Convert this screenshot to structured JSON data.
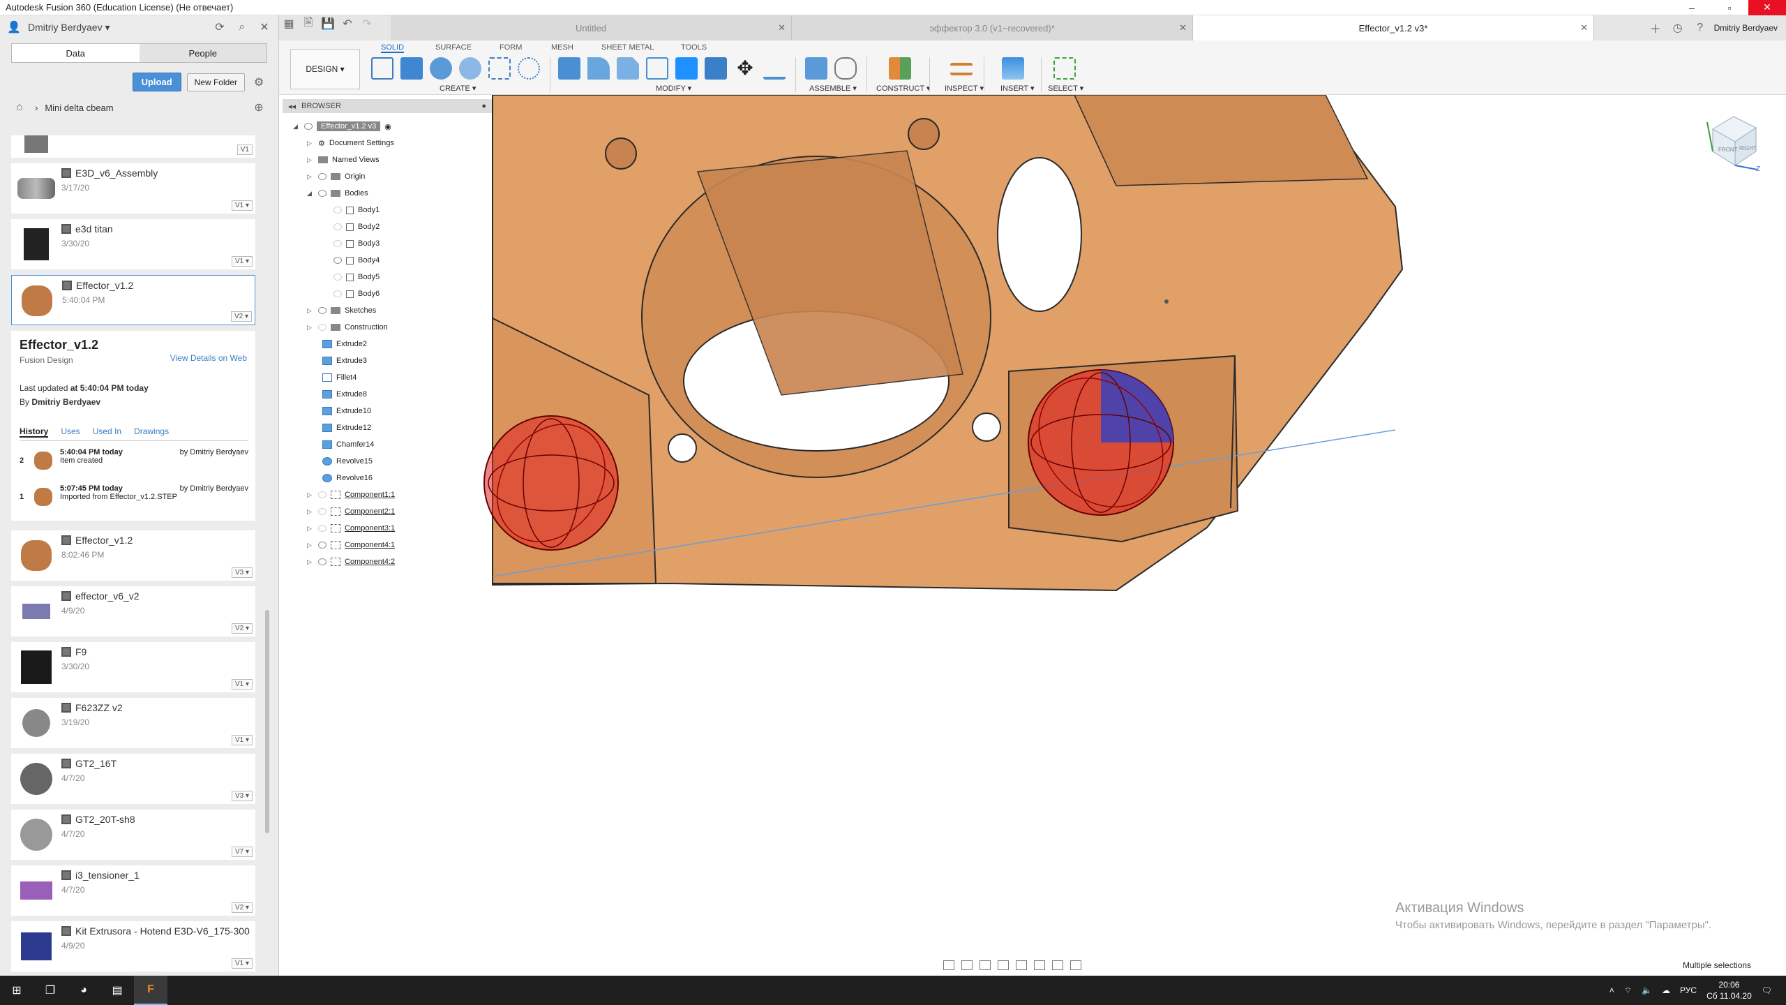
{
  "window": {
    "title": "Autodesk Fusion 360 (Education License) (Не отвечает)"
  },
  "data_panel": {
    "user": "Dmitriy Berdyaev",
    "tabs": [
      "Data",
      "People"
    ],
    "upload_label": "Upload",
    "new_folder_label": "New Folder",
    "project": "Mini delta cbeam",
    "items_top": [
      {
        "name": "",
        "date": "",
        "version": "V1"
      },
      {
        "name": "E3D_v6_Assembly",
        "date": "3/17/20",
        "version": "V1"
      },
      {
        "name": "e3d titan",
        "date": "3/30/20",
        "version": "V1"
      },
      {
        "name": "Effector_v1.2",
        "date": "5:40:04 PM",
        "version": "V2"
      }
    ],
    "details": {
      "title": "Effector_v1.2",
      "type": "Fusion Design",
      "view_link": "View Details on Web",
      "updated_prefix": "Last updated ",
      "updated_value": "at 5:40:04 PM today",
      "by_prefix": "By ",
      "by_value": "Dmitriy Berdyaev",
      "tabs": [
        "History",
        "Uses",
        "Used In",
        "Drawings"
      ],
      "history": [
        {
          "n": "2",
          "time": "5:40:04 PM today",
          "note": "Item created",
          "user": "by Dmitriy Berdyaev"
        },
        {
          "n": "1",
          "time": "5:07:45 PM today",
          "note": "Imported from Effector_v1.2.STEP",
          "user": "by Dmitriy Berdyaev"
        }
      ]
    },
    "items_bottom": [
      {
        "name": "Effector_v1.2",
        "date": "8:02:46 PM",
        "version": "V3"
      },
      {
        "name": "effector_v6_v2",
        "date": "4/9/20",
        "version": "V2"
      },
      {
        "name": "F9",
        "date": "3/30/20",
        "version": "V1"
      },
      {
        "name": "F623ZZ v2",
        "date": "3/19/20",
        "version": "V1"
      },
      {
        "name": "GT2_16T",
        "date": "4/7/20",
        "version": "V3"
      },
      {
        "name": "GT2_20T-sh8",
        "date": "4/7/20",
        "version": "V7"
      },
      {
        "name": "i3_tensioner_1",
        "date": "4/7/20",
        "version": "V2"
      },
      {
        "name": "Kit Extrusora - Hotend E3D-V6_175-300",
        "date": "4/9/20",
        "version": "V1"
      }
    ]
  },
  "doc_tabs": [
    {
      "label": "Untitled"
    },
    {
      "label": "эффектор 3.0 (v1~recovered)*"
    },
    {
      "label": "Effector_v1.2 v3*"
    }
  ],
  "tabbar_user": "Dmitriy Berdyaev",
  "toolbar": {
    "workspace": "DESIGN",
    "tabs": [
      "SOLID",
      "SURFACE",
      "FORM",
      "MESH",
      "SHEET METAL",
      "TOOLS"
    ],
    "groups": [
      "CREATE",
      "MODIFY",
      "ASSEMBLE",
      "CONSTRUCT",
      "INSPECT",
      "INSERT",
      "SELECT"
    ]
  },
  "browser": {
    "title": "BROWSER",
    "root": "Effector_v1.2 v3",
    "nodes": [
      "Document Settings",
      "Named Views",
      "Origin",
      "Bodies",
      "Body1",
      "Body2",
      "Body3",
      "Body4",
      "Body5",
      "Body6",
      "Sketches",
      "Construction",
      "Extrude2",
      "Extrude3",
      "Fillet4",
      "Extrude8",
      "Extrude10",
      "Extrude12",
      "Chamfer14",
      "Revolve15",
      "Revolve16",
      "Component1:1",
      "Component2:1",
      "Component3:1",
      "Component4:1",
      "Component4:2"
    ]
  },
  "viewcube": {
    "face_front": "FRONT",
    "face_right": "RIGHT",
    "axis": "Z"
  },
  "status": {
    "selection": "Multiple selections"
  },
  "watermark": {
    "line1": "Активация Windows",
    "line2": "Чтобы активировать Windows, перейдите в раздел \"Параметры\"."
  },
  "taskbar": {
    "lang": "РУС",
    "time": "20:06",
    "date": "Сб 11.04.20"
  },
  "colors": {
    "accent": "#1a6fc4",
    "part": "#e0a068",
    "sphere_red": "#e02020",
    "sphere_blue": "#2040d0"
  }
}
